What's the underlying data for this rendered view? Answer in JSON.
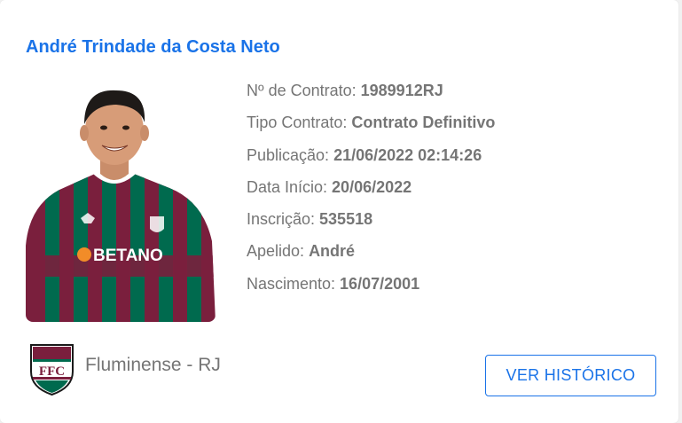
{
  "player": {
    "name": "André Trindade da Costa Neto",
    "photo_alt": "André"
  },
  "details": [
    {
      "label": "Nº de Contrato: ",
      "value": "1989912RJ"
    },
    {
      "label": "Tipo Contrato: ",
      "value": "Contrato Definitivo"
    },
    {
      "label": "Publicação: ",
      "value": "21/06/2022 02:14:26"
    },
    {
      "label": "Data Início: ",
      "value": "20/06/2022"
    },
    {
      "label": "Inscrição: ",
      "value": "535518"
    },
    {
      "label": "Apelido: ",
      "value": "André"
    },
    {
      "label": "Nascimento: ",
      "value": "16/07/2001"
    }
  ],
  "club": {
    "name": "Fluminense - RJ",
    "logo_icon": "fluminense-crest-icon"
  },
  "actions": {
    "history_label": "VER HISTÓRICO"
  },
  "colors": {
    "accent": "#1a73e8",
    "text_muted": "#757575",
    "jersey_grena": "#7a1f3d",
    "jersey_green": "#006a4e"
  }
}
